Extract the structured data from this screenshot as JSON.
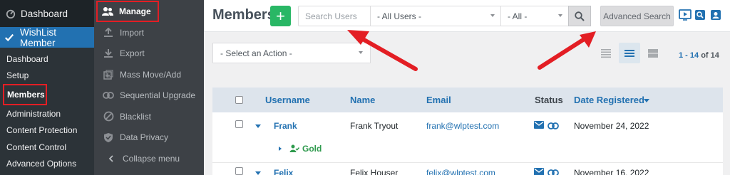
{
  "wp_menu": {
    "dashboard": "Dashboard",
    "active_plugin": "WishList Member",
    "sub_items": [
      "Dashboard",
      "Setup",
      "Members",
      "Administration",
      "Content Protection",
      "Content Control",
      "Advanced Options"
    ]
  },
  "wlm_nav": {
    "items": [
      "Manage",
      "Import",
      "Export",
      "Mass Move/Add",
      "Sequential Upgrade",
      "Blacklist",
      "Data Privacy"
    ],
    "collapse": "Collapse menu"
  },
  "header": {
    "title": "Members",
    "add_label": "+",
    "search_placeholder": "Search Users",
    "users_filter": "- All Users -",
    "all_filter": "- All -",
    "advanced_search": "Advanced Search"
  },
  "toolbar": {
    "action_select": "- Select an Action -",
    "pager_range": "1 - 14",
    "pager_of": "of 14"
  },
  "table": {
    "columns": {
      "username": "Username",
      "name": "Name",
      "email": "Email",
      "status": "Status",
      "date": "Date Registered"
    },
    "rows": [
      {
        "username": "Frank",
        "name": "Frank Tryout",
        "email": "frank@wlptest.com",
        "date": "November 24, 2022",
        "level": "Gold"
      },
      {
        "username": "Felix",
        "name": "Felix Houser",
        "email": "felix@wlptest.com",
        "date": "November 16, 2022"
      }
    ]
  },
  "colors": {
    "accent": "#2271b1",
    "add_green": "#29b765",
    "annotation_red": "#e31e24"
  }
}
